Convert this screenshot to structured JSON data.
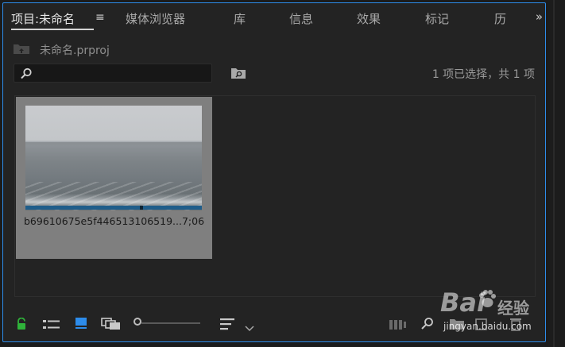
{
  "tabs": [
    {
      "label": "项目:未命名"
    },
    {
      "label": "媒体浏览器"
    },
    {
      "label": "库"
    },
    {
      "label": "信息"
    },
    {
      "label": "效果"
    },
    {
      "label": "标记"
    },
    {
      "label": "历"
    }
  ],
  "tab_menu_glyph": "≡",
  "more_glyph": "»",
  "project": {
    "file_name": "未命名.prproj"
  },
  "search": {
    "placeholder": ""
  },
  "selection_status": "1 项已选择，共 1 项",
  "clips": [
    {
      "name": "b69610675e5f446513106519...7;06",
      "playhead_fraction": 0.65
    }
  ],
  "toolbar": {
    "icons": [
      "lock-icon",
      "list-view-icon",
      "icon-view-icon",
      "freeform-view-icon",
      "zoom-slider",
      "sort-icon",
      "automate-to-sequence-icon",
      "find-icon",
      "new-bin-icon",
      "new-item-icon",
      "delete-icon"
    ],
    "zoom_level": 0.0
  },
  "watermark": {
    "brand": "Bai",
    "brand_cn": "经验",
    "url": "jingyan.baidu.com"
  },
  "colors": {
    "accent": "#2d8ceb",
    "lock": "#2fb33a",
    "selected_view": "#2d8ceb"
  }
}
